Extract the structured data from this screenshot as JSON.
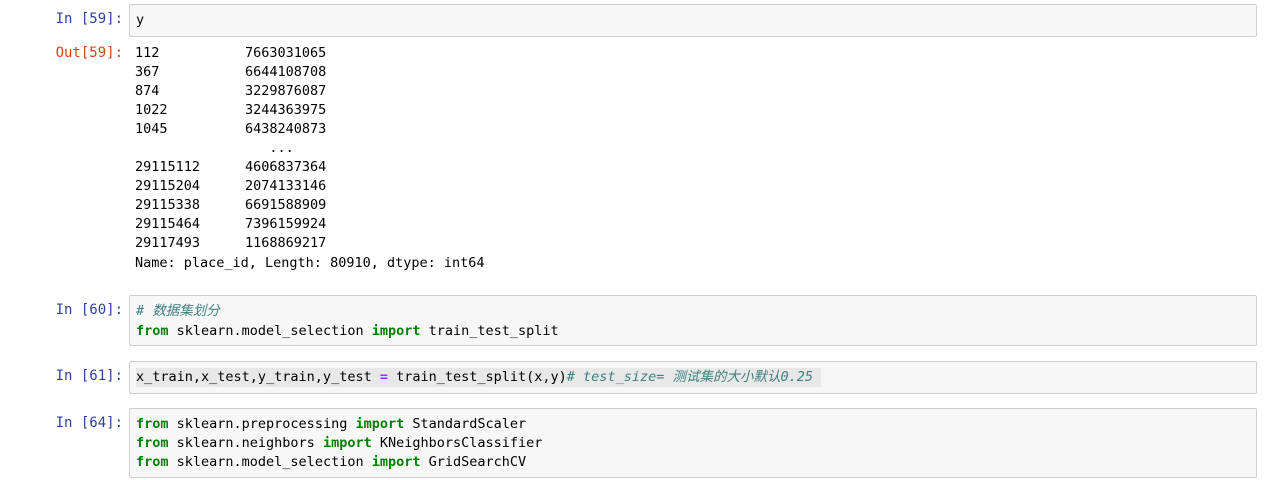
{
  "cells": {
    "c59": {
      "in_prompt": "In [59]:",
      "code": "y",
      "out_prompt": "Out[59]:",
      "output_rows": [
        {
          "index": "112",
          "value": "7663031065"
        },
        {
          "index": "367",
          "value": "6644108708"
        },
        {
          "index": "874",
          "value": "3229876087"
        },
        {
          "index": "1022",
          "value": "3244363975"
        },
        {
          "index": "1045",
          "value": "6438240873"
        },
        {
          "index": "",
          "value": "   ..."
        },
        {
          "index": "29115112",
          "value": "4606837364"
        },
        {
          "index": "29115204",
          "value": "2074133146"
        },
        {
          "index": "29115338",
          "value": "6691588909"
        },
        {
          "index": "29115464",
          "value": "7396159924"
        },
        {
          "index": "29117493",
          "value": "1168869217"
        }
      ],
      "summary": "Name: place_id, Length: 80910, dtype: int64"
    },
    "c60": {
      "in_prompt": "In [60]:",
      "comment": "# 数据集划分",
      "line2": {
        "kw_from": "from",
        "module": " sklearn.model_selection ",
        "kw_import": "import",
        "name": " train_test_split"
      }
    },
    "c61": {
      "in_prompt": "In [61]:",
      "lhs": "x_train,x_test,y_train,y_test ",
      "eq": "=",
      "rhs": " train_test_split(x,y)",
      "comment": "# test_size= 测试集的大小默认0.25"
    },
    "c64": {
      "in_prompt": "In [64]:",
      "lines": [
        {
          "kw_from": "from",
          "module": " sklearn.preprocessing ",
          "kw_import": "import",
          "name": " StandardScaler"
        },
        {
          "kw_from": "from",
          "module": " sklearn.neighbors ",
          "kw_import": "import",
          "name": " KNeighborsClassifier"
        },
        {
          "kw_from": "from",
          "module": " sklearn.model_selection ",
          "kw_import": "import",
          "name": " GridSearchCV"
        }
      ]
    }
  },
  "colors": {
    "in_prompt": "#303F9F",
    "out_prompt": "#D84315",
    "keyword": "#008000",
    "operator": "#AA22FF",
    "comment": "#408080",
    "cell_bg": "#f7f7f7",
    "cell_border": "#cfcfcf"
  }
}
